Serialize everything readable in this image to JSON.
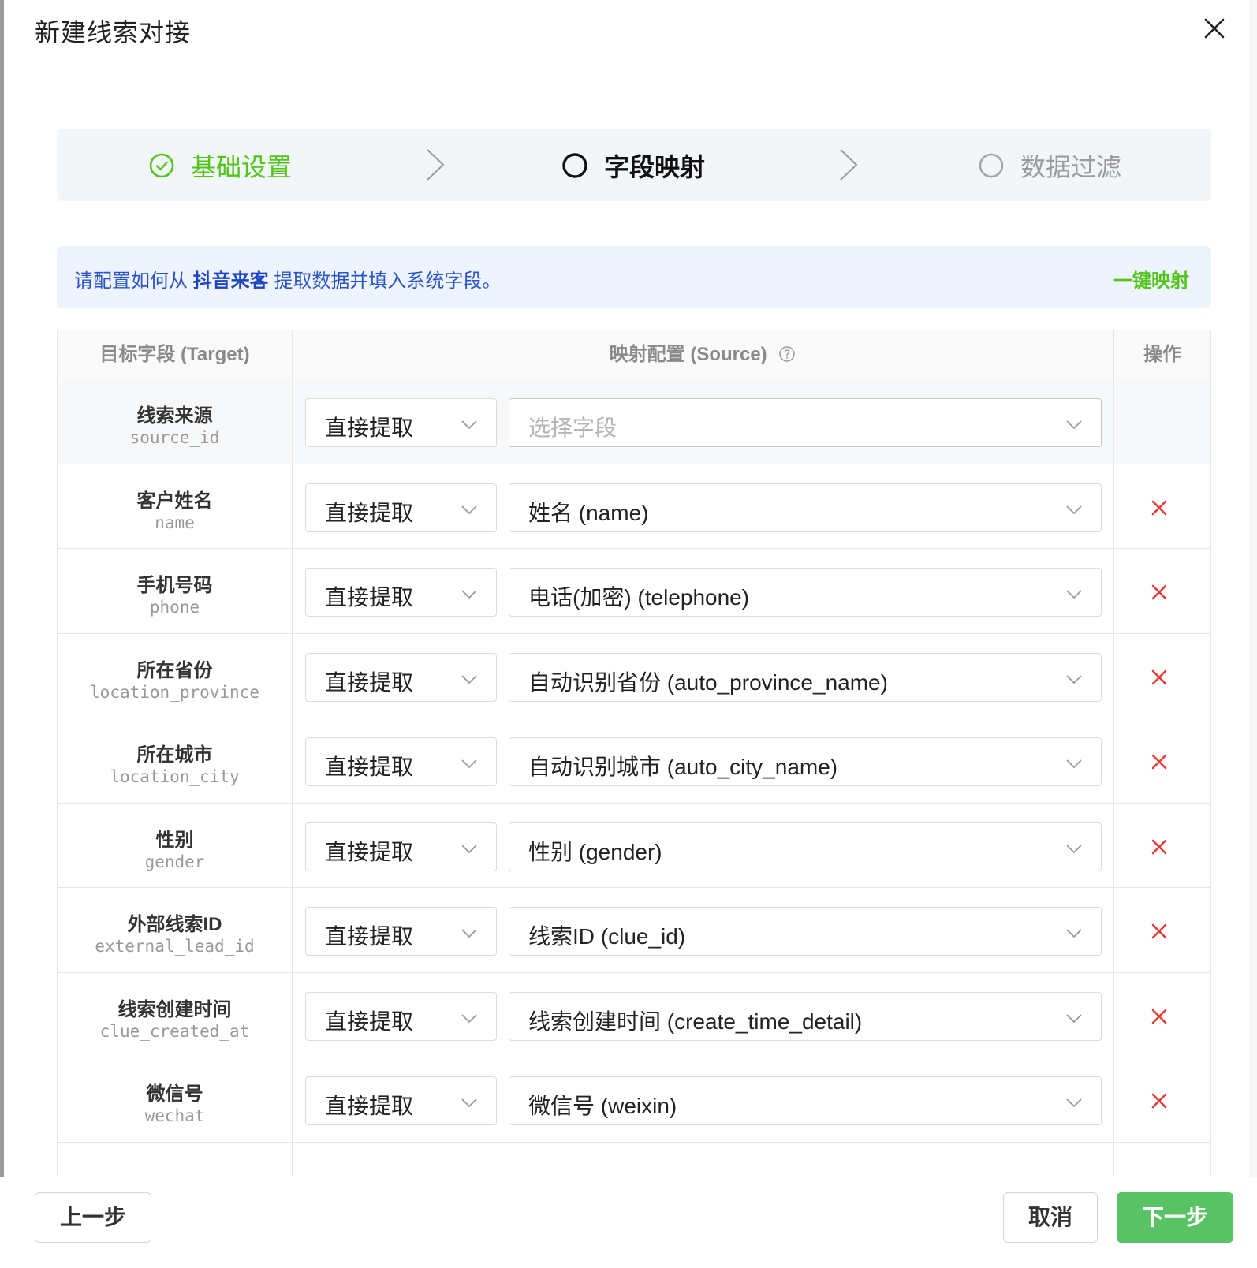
{
  "dialog": {
    "title": "新建线索对接"
  },
  "steps": [
    {
      "label": "基础设置",
      "status": "finished"
    },
    {
      "label": "字段映射",
      "status": "current"
    },
    {
      "label": "数据过滤",
      "status": "waiting"
    }
  ],
  "banner": {
    "prefix": "请配置如何从",
    "source_name": "抖音来客",
    "suffix": "提取数据并填入系统字段。",
    "one_click_label": "一键映射"
  },
  "table": {
    "headers": {
      "target": "目标字段 (Target)",
      "source": "映射配置 (Source)",
      "operation": "操作"
    },
    "rows": [
      {
        "label": "线索来源",
        "key": "source_id",
        "mode": "直接提取",
        "field": "选择字段",
        "field_is_placeholder": true,
        "deletable": false
      },
      {
        "label": "客户姓名",
        "key": "name",
        "mode": "直接提取",
        "field": "姓名 (name)",
        "deletable": true
      },
      {
        "label": "手机号码",
        "key": "phone",
        "mode": "直接提取",
        "field": "电话(加密) (telephone)",
        "deletable": true
      },
      {
        "label": "所在省份",
        "key": "location_province",
        "mode": "直接提取",
        "field": "自动识别省份 (auto_province_name)",
        "deletable": true
      },
      {
        "label": "所在城市",
        "key": "location_city",
        "mode": "直接提取",
        "field": "自动识别城市 (auto_city_name)",
        "deletable": true
      },
      {
        "label": "性别",
        "key": "gender",
        "mode": "直接提取",
        "field": "性别 (gender)",
        "deletable": true
      },
      {
        "label": "外部线索ID",
        "key": "external_lead_id",
        "mode": "直接提取",
        "field": "线索ID (clue_id)",
        "deletable": true
      },
      {
        "label": "线索创建时间",
        "key": "clue_created_at",
        "mode": "直接提取",
        "field": "线索创建时间 (create_time_detail)",
        "deletable": true
      },
      {
        "label": "微信号",
        "key": "wechat",
        "mode": "直接提取",
        "field": "微信号 (weixin)",
        "deletable": true
      }
    ]
  },
  "footer": {
    "prev_label": "上一步",
    "cancel_label": "取消",
    "next_label": "下一步"
  },
  "colors": {
    "success": "#52c41a",
    "primary_text": "#2a54c7",
    "danger": "#e53935",
    "next_button": "#58c265"
  }
}
